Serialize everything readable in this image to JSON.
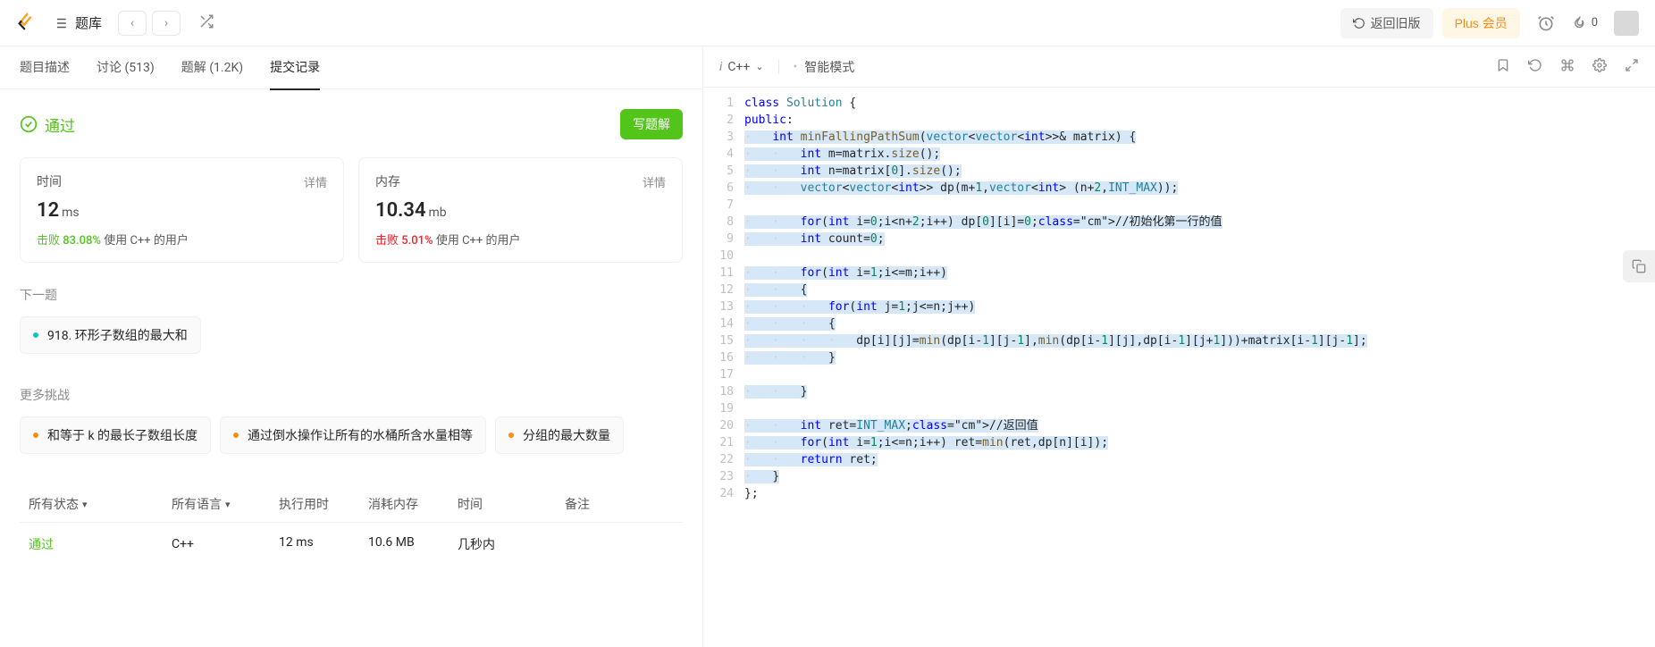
{
  "topbar": {
    "problems_label": "题库",
    "old_version": "返回旧版",
    "plus": "Plus 会员",
    "fire_count": "0"
  },
  "tabs": {
    "description": "题目描述",
    "discuss": "讨论 (513)",
    "solutions": "题解 (1.2K)",
    "submissions": "提交记录"
  },
  "result": {
    "status": "通过",
    "write_solution": "写题解"
  },
  "stats": {
    "time_label": "时间",
    "time_value": "12",
    "time_unit": "ms",
    "time_beat_prefix": "击败",
    "time_pct": "83.08%",
    "time_suffix": "使用 C++ 的用户",
    "memory_label": "内存",
    "memory_value": "10.34",
    "memory_unit": "mb",
    "memory_beat_prefix": "击败",
    "memory_pct": "5.01%",
    "memory_suffix": "使用 C++ 的用户",
    "detail": "详情"
  },
  "next": {
    "title": "下一题",
    "item": "918. 环形子数组的最大和"
  },
  "more": {
    "title": "更多挑战",
    "items": [
      "和等于 k 的最长子数组长度",
      "通过倒水操作让所有的水桶所含水量相等",
      "分组的最大数量"
    ]
  },
  "table": {
    "col_status": "所有状态",
    "col_lang": "所有语言",
    "col_runtime": "执行用时",
    "col_memory": "消耗内存",
    "col_time": "时间",
    "col_note": "备注",
    "row": {
      "status": "通过",
      "lang": "C++",
      "runtime": "12 ms",
      "memory": "10.6 MB",
      "time": "几秒内",
      "note": ""
    }
  },
  "editor": {
    "lang": "C++",
    "smart": "智能模式"
  },
  "code": [
    {
      "n": 1,
      "raw": "class Solution {",
      "hl": false
    },
    {
      "n": 2,
      "raw": "public:",
      "hl": false
    },
    {
      "n": 3,
      "raw": "    int minFallingPathSum(vector<vector<int>>& matrix) {",
      "hl": true
    },
    {
      "n": 4,
      "raw": "        int m=matrix.size();",
      "hl": true
    },
    {
      "n": 5,
      "raw": "        int n=matrix[0].size();",
      "hl": true
    },
    {
      "n": 6,
      "raw": "        vector<vector<int>> dp(m+1,vector<int> (n+2,INT_MAX));",
      "hl": true
    },
    {
      "n": 7,
      "raw": "",
      "hl": true
    },
    {
      "n": 8,
      "raw": "        for(int i=0;i<n+2;i++) dp[0][i]=0;//初始化第一行的值",
      "hl": true
    },
    {
      "n": 9,
      "raw": "        int count=0;",
      "hl": true
    },
    {
      "n": 10,
      "raw": "",
      "hl": true
    },
    {
      "n": 11,
      "raw": "        for(int i=1;i<=m;i++)",
      "hl": true
    },
    {
      "n": 12,
      "raw": "        {",
      "hl": true
    },
    {
      "n": 13,
      "raw": "            for(int j=1;j<=n;j++)",
      "hl": true
    },
    {
      "n": 14,
      "raw": "            {",
      "hl": true
    },
    {
      "n": 15,
      "raw": "                dp[i][j]=min(dp[i-1][j-1],min(dp[i-1][j],dp[i-1][j+1]))+matrix[i-1][j-1];",
      "hl": true
    },
    {
      "n": 16,
      "raw": "            }",
      "hl": true
    },
    {
      "n": 17,
      "raw": "",
      "hl": true
    },
    {
      "n": 18,
      "raw": "        }",
      "hl": true
    },
    {
      "n": 19,
      "raw": "",
      "hl": true
    },
    {
      "n": 20,
      "raw": "        int ret=INT_MAX;//返回值",
      "hl": true
    },
    {
      "n": 21,
      "raw": "        for(int i=1;i<=n;i++) ret=min(ret,dp[n][i]);",
      "hl": true
    },
    {
      "n": 22,
      "raw": "        return ret;",
      "hl": true
    },
    {
      "n": 23,
      "raw": "    }",
      "hl": true
    },
    {
      "n": 24,
      "raw": "};",
      "hl": false
    }
  ]
}
